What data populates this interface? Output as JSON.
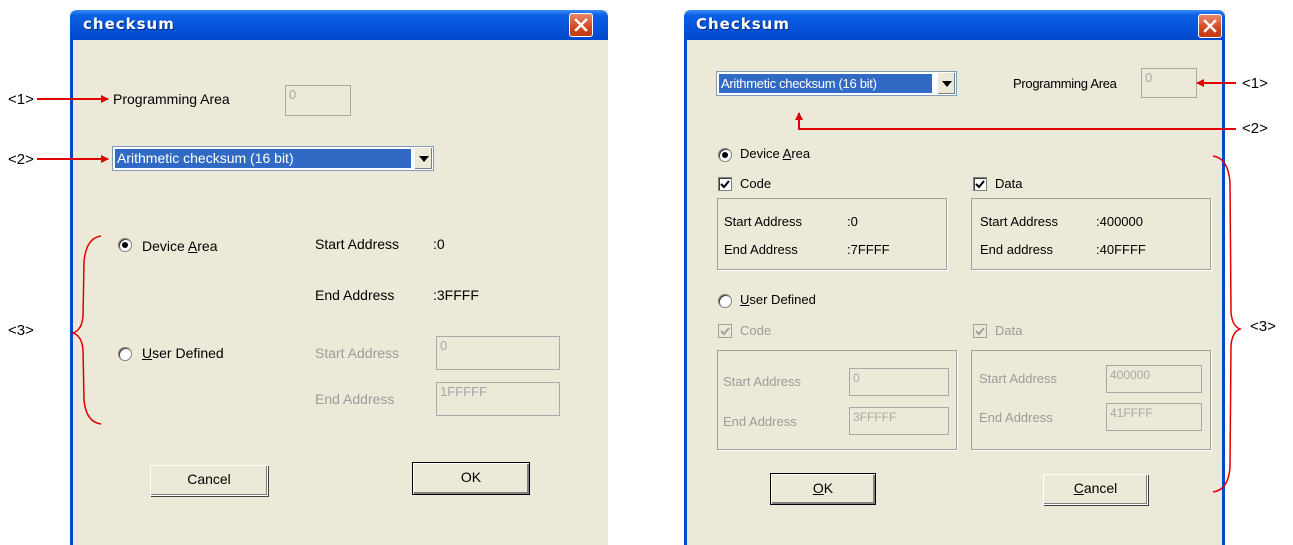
{
  "left": {
    "title": "checksum",
    "programming_area_label": "Programming Area",
    "programming_area_value": "0",
    "checksum_type": "Arithmetic checksum (16 bit)",
    "device_area_pre": "Device ",
    "device_area_key": "A",
    "device_area_post": "rea",
    "start_address_label": "Start Address",
    "start_address_value": ":0",
    "end_address_label": "End Address",
    "end_address_value": ":3FFFF",
    "user_defined_key": "U",
    "user_defined_post": "ser Defined",
    "ud_start_label": "Start Address",
    "ud_start_value": "0",
    "ud_end_label": "End Address",
    "ud_end_value": "1FFFFF",
    "cancel_label": "Cancel",
    "ok_label": "OK"
  },
  "right": {
    "title": "Checksum",
    "checksum_type": "Arithmetic checksum (16 bit)",
    "programming_area_label": "Programming Area",
    "programming_area_value": "0",
    "device_area_pre": "Device ",
    "device_area_key": "A",
    "device_area_post": "rea",
    "code_label": "Code",
    "data_label": "Data",
    "code_start_label": "Start Address",
    "code_start_value": ":0",
    "code_end_label": "End Address",
    "code_end_value": ":7FFFF",
    "data_start_label": "Start Address",
    "data_start_value": ":400000",
    "data_end_label": "End address",
    "data_end_value": ":40FFFF",
    "user_defined_key": "U",
    "user_defined_post": "ser Defined",
    "ud_code_label": "Code",
    "ud_data_label": "Data",
    "ud_code_start_label": "Start Address",
    "ud_code_start_value": "0",
    "ud_code_end_label": "End Address",
    "ud_code_end_value": "3FFFFF",
    "ud_data_start_label": "Start Address",
    "ud_data_start_value": "400000",
    "ud_data_end_label": "End Address",
    "ud_data_end_value": "41FFFF",
    "ok_key": "O",
    "ok_post": "K",
    "cancel_key": "C",
    "cancel_post": "ancel"
  },
  "callouts": {
    "one": "<1>",
    "two": "<2>",
    "three": "<3>"
  },
  "colors": {
    "title_bar": "#0553d8",
    "dialog_bg": "#ece9d8",
    "selection": "#316ac5",
    "callout_arrow": "#e00000"
  },
  "icons": [
    "close-icon",
    "dropdown-arrow-icon",
    "checkmark-icon",
    "radio-dot-icon",
    "callout-arrow-icon",
    "brace-icon"
  ]
}
